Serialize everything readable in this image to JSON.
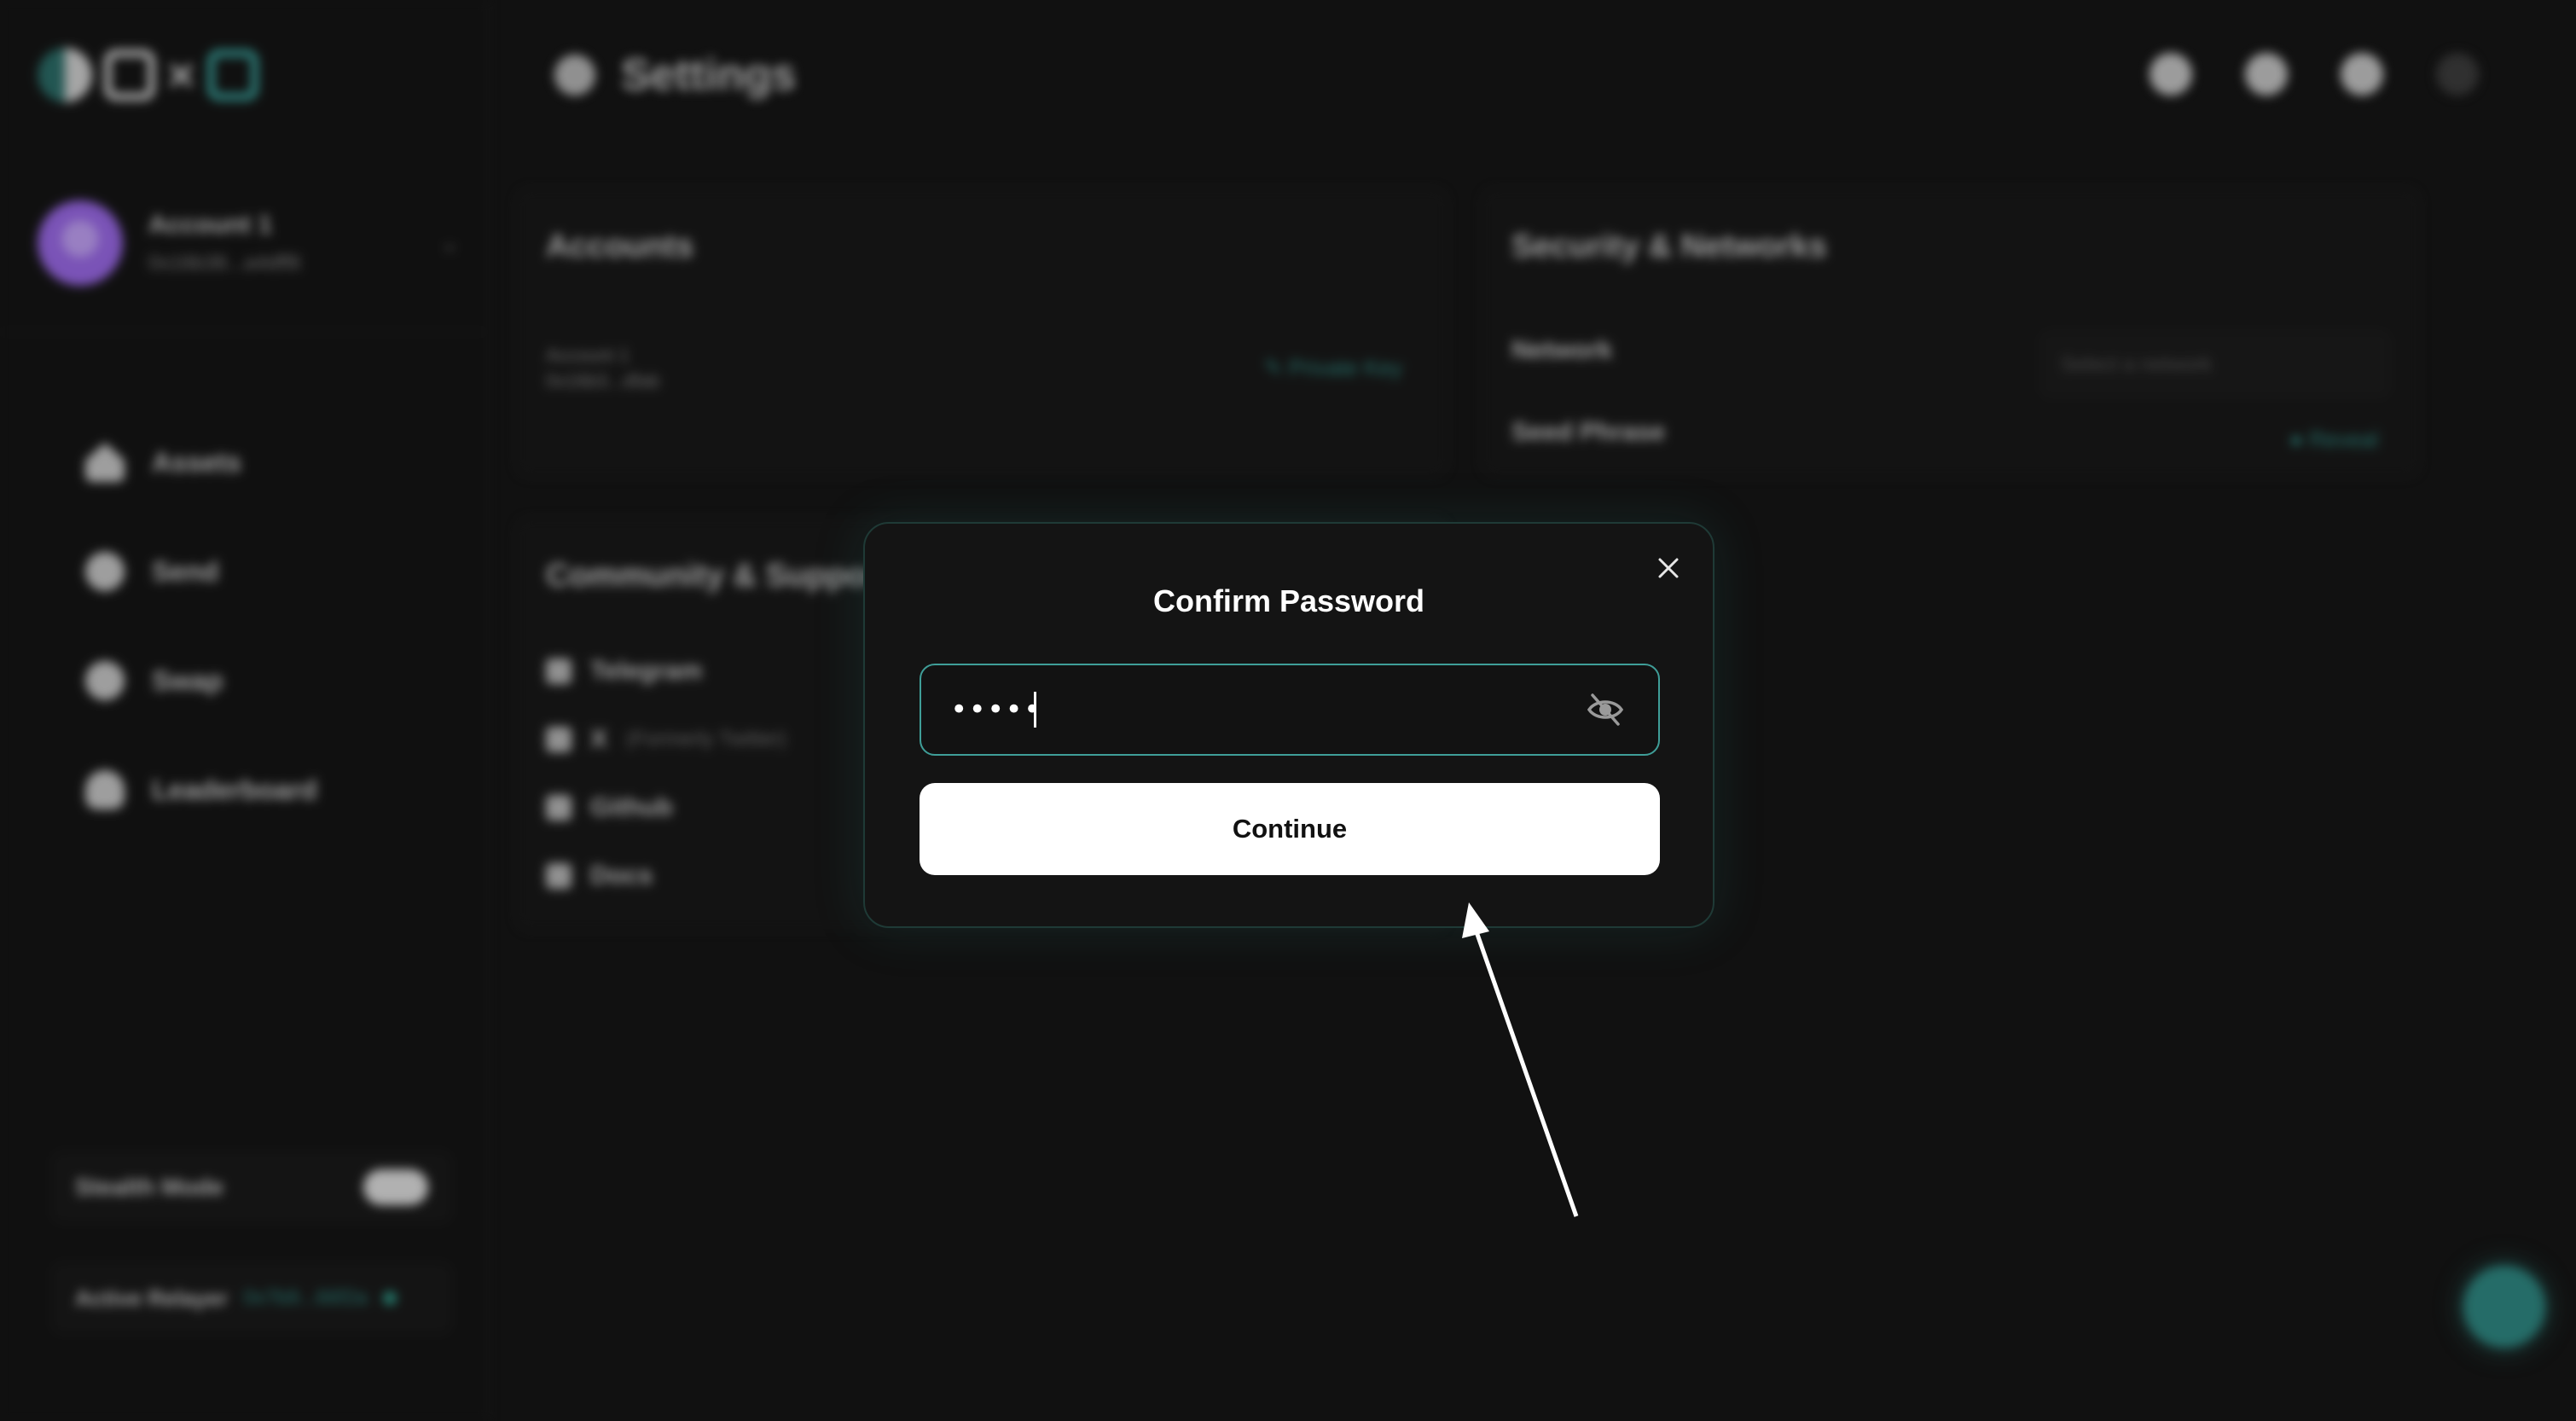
{
  "app": {
    "brand_icon": "oxo-logo"
  },
  "header": {
    "title": "Settings",
    "icons": [
      "globe-icon",
      "clock-icon",
      "info-icon",
      "power-icon"
    ]
  },
  "sidebar": {
    "account": {
      "name": "Account 1",
      "address": "0x16b38...a4dff8"
    },
    "items": [
      {
        "label": "Assets",
        "icon": "home-icon"
      },
      {
        "label": "Send",
        "icon": "send-icon"
      },
      {
        "label": "Swap",
        "icon": "swap-icon"
      },
      {
        "label": "Leaderboard",
        "icon": "trophy-icon"
      }
    ],
    "stealth_mode": {
      "label": "Stealth Mode",
      "enabled": true
    },
    "relayer": {
      "label": "Active Relayer",
      "value": "0x7b9...66f2a"
    }
  },
  "cards": {
    "accounts": {
      "title": "Accounts",
      "account_name": "Account 1",
      "account_addr": "0x16b3...dfab",
      "private_key_label": "Private Key"
    },
    "security": {
      "title": "Security & Networks",
      "network_label": "Network",
      "network_placeholder": "Select a network",
      "seed_label": "Seed Phrase",
      "reveal_label": "Reveal"
    },
    "community": {
      "title": "Community & Support",
      "links": [
        {
          "label": "Telegram",
          "note": ""
        },
        {
          "label": "X",
          "note": "(Formerly Twitter)"
        },
        {
          "label": "Github",
          "note": ""
        },
        {
          "label": "Docs",
          "note": ""
        }
      ]
    }
  },
  "modal": {
    "title": "Confirm Password",
    "password_value": "••••••••",
    "continue_label": "Continue"
  },
  "colors": {
    "accent": "#3f9e98",
    "background": "#131313",
    "modal_border": "#1f3a36"
  }
}
